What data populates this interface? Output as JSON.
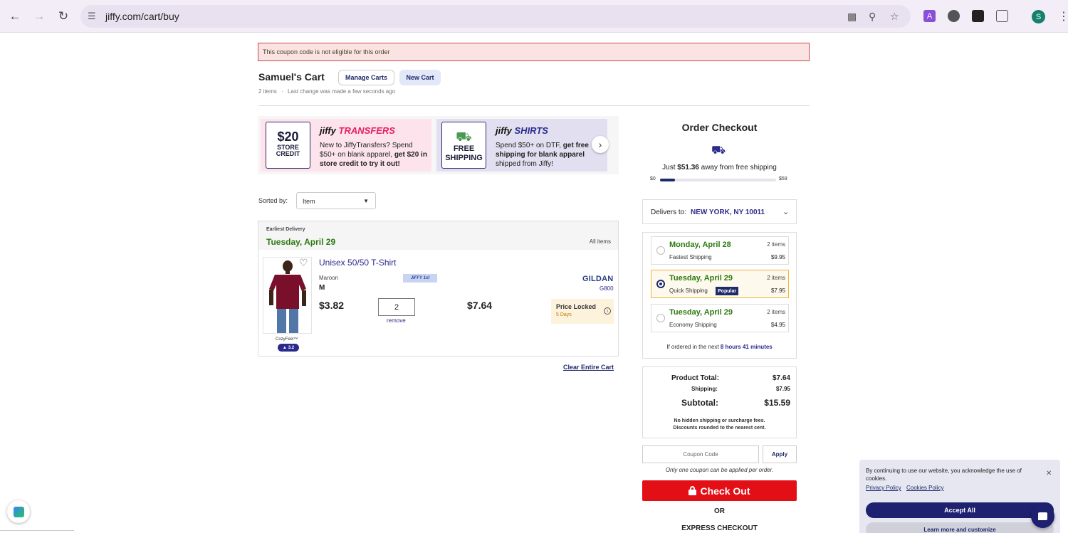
{
  "browser": {
    "url": "jiffy.com/cart/buy",
    "profile_initial": "S"
  },
  "alert": "This coupon code is not eligible for this order",
  "cart": {
    "title": "Samuel's Cart",
    "manage_label": "Manage Carts",
    "new_label": "New Cart",
    "item_count": "2 items",
    "last_change": "Last change was made a few seconds ago"
  },
  "promos": [
    {
      "badge_amount": "$20",
      "badge_line1": "STORE",
      "badge_line2": "CREDIT",
      "brand1": "jiffy",
      "brand2": "TRANSFERS",
      "text_plain": "New to JiffyTransfers? Spend $50+ on blank apparel, ",
      "text_bold": "get $20 in store credit to try it out!"
    },
    {
      "badge_line1": "FREE",
      "badge_line2": "SHIPPING",
      "brand1": "jiffy",
      "brand2": "SHIRTS",
      "text_plain": "Spend $50+ on DTF, ",
      "text_bold": "get free shipping for blank apparel",
      "text_end": " shipped from Jiffy!"
    }
  ],
  "sort": {
    "label": "Sorted by:",
    "value": "Item"
  },
  "delivery_group": {
    "eyebrow": "Earliest Delivery",
    "date": "Tuesday, April 29",
    "all_items": "All items"
  },
  "item": {
    "name": "Unisex 50/50 T-Shirt",
    "color": "Maroon",
    "size": "M",
    "tag": "JIFFY 1st",
    "unit_price": "$3.82",
    "quantity": "2",
    "remove": "remove",
    "line_price": "$7.64",
    "brand": "GILDAN",
    "style": "G800",
    "locked_title": "Price Locked",
    "locked_days": "5 Days",
    "fabric": "CozyFeel™",
    "rating": "3.2",
    "shirt_color": "#7a0f2b"
  },
  "clear_cart": "Clear Entire Cart",
  "checkout": {
    "title": "Order Checkout",
    "free_ship_prefix": "Just ",
    "free_ship_amount": "$51.36",
    "free_ship_suffix": " away from free shipping",
    "bar_min": "$0",
    "bar_max": "$59",
    "progress_fraction": 0.13,
    "deliver_label": "Delivers to:",
    "deliver_value": "NEW YORK, NY 10011",
    "options": [
      {
        "date": "Monday, April 28",
        "count": "2 items",
        "method": "Fastest Shipping",
        "price": "$9.95",
        "selected": false,
        "popular": ""
      },
      {
        "date": "Tuesday, April 29",
        "count": "2 items",
        "method": "Quick Shipping",
        "price": "$7.95",
        "selected": true,
        "popular": "Popular"
      },
      {
        "date": "Tuesday, April 29",
        "count": "2 items",
        "method": "Economy Shipping",
        "price": "$4.95",
        "selected": false,
        "popular": ""
      }
    ],
    "cutoff_prefix": "If ordered in the next ",
    "cutoff_time": "8 hours 41 minutes",
    "product_total_label": "Product Total:",
    "product_total": "$7.64",
    "shipping_label": "Shipping:",
    "shipping": "$7.95",
    "subtotal_label": "Subtotal:",
    "subtotal": "$15.59",
    "note1": "No hidden shipping or surcharge fees.",
    "note2": "Discounts rounded to the nearest cent.",
    "coupon_placeholder": "Coupon Code",
    "apply_label": "Apply",
    "coupon_note": "Only one coupon can be applied per order.",
    "checkout_label": "Check Out",
    "or_label": "OR",
    "express_label": "EXPRESS CHECKOUT"
  },
  "cookie": {
    "text": "By continuing to use our website, you acknowledge the use of cookies.",
    "privacy": "Privacy Policy",
    "cookies": "Cookies Policy",
    "accept": "Accept All",
    "learn": "Learn more and customize"
  },
  "colors": {
    "brand_navy": "#1f2a6b",
    "checkout_red": "#e30f16",
    "delivery_green": "#2c7a0e"
  }
}
